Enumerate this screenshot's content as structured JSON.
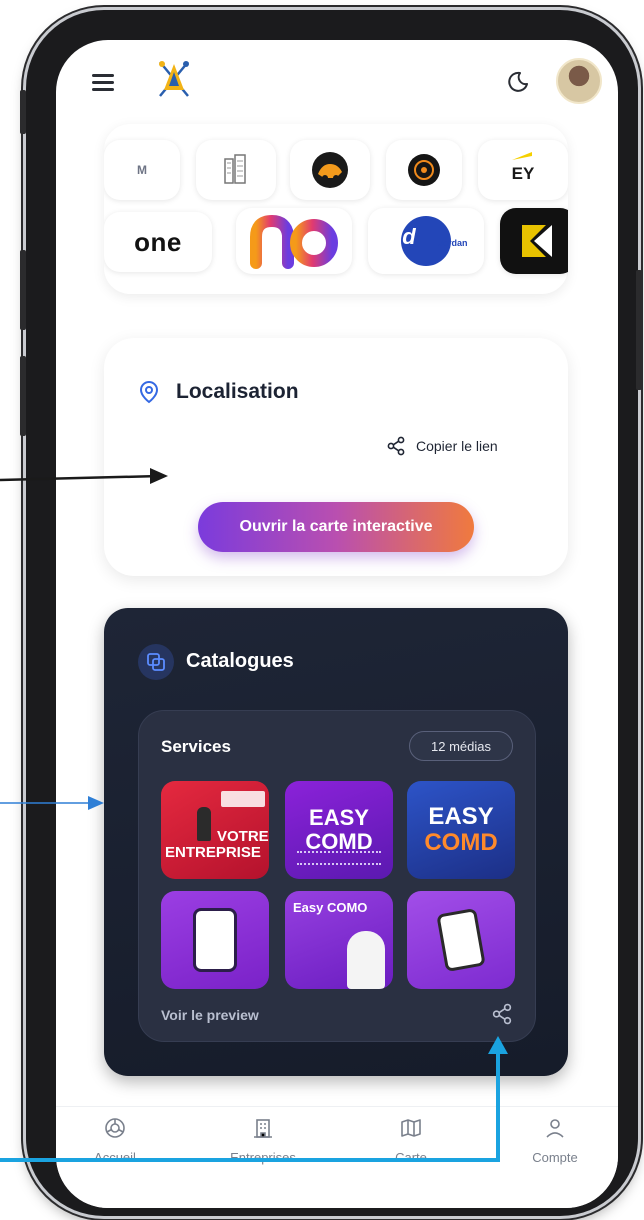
{
  "header": {
    "menu_icon": "hamburger-icon",
    "logo_icon": "app-logo",
    "theme_icon": "moon-icon",
    "avatar_icon": "user-avatar"
  },
  "partners": {
    "row1": [
      {
        "label": "M"
      },
      {
        "icon": "building-logo"
      },
      {
        "icon": "orange-car-logo"
      },
      {
        "icon": "orange-ring-logo"
      },
      {
        "label": "EY"
      }
    ],
    "row2": [
      {
        "label": "one"
      },
      {
        "icon": "rainbow-n-logo"
      },
      {
        "label": "Jd",
        "sub": "Jerdan"
      },
      {
        "icon": "black-arrow-logo"
      }
    ]
  },
  "location": {
    "title": "Localisation",
    "copy_link_label": "Copier le lien",
    "open_map_label": "Ouvrir la carte interactive"
  },
  "catalogues": {
    "title": "Catalogues",
    "services": {
      "title": "Services",
      "count_badge": "12 médias",
      "thumbnails": [
        {
          "line1": "VOTRE",
          "line2": "ENTREPRISE"
        },
        {
          "line1": "EASY",
          "line2": "COMD"
        },
        {
          "line1": "EASY",
          "line2": "COMD"
        },
        {
          "line1": "",
          "line2": ""
        },
        {
          "line1": "Easy COMO",
          "line2": ""
        },
        {
          "line1": "",
          "line2": ""
        }
      ],
      "preview_label": "Voir le preview",
      "share_icon": "share-icon"
    }
  },
  "bottom_nav": [
    {
      "label": "Accueil",
      "icon": "home-icon"
    },
    {
      "label": "Entreprises",
      "icon": "building-icon"
    },
    {
      "label": "Carte",
      "icon": "map-icon"
    },
    {
      "label": "Compte",
      "icon": "user-icon"
    }
  ],
  "colors": {
    "accent_gradient_start": "#7b3bdc",
    "accent_gradient_end": "#f07a3e",
    "catalogue_bg": "#1e2536",
    "annotation_arrow": "#1aa3e0"
  }
}
